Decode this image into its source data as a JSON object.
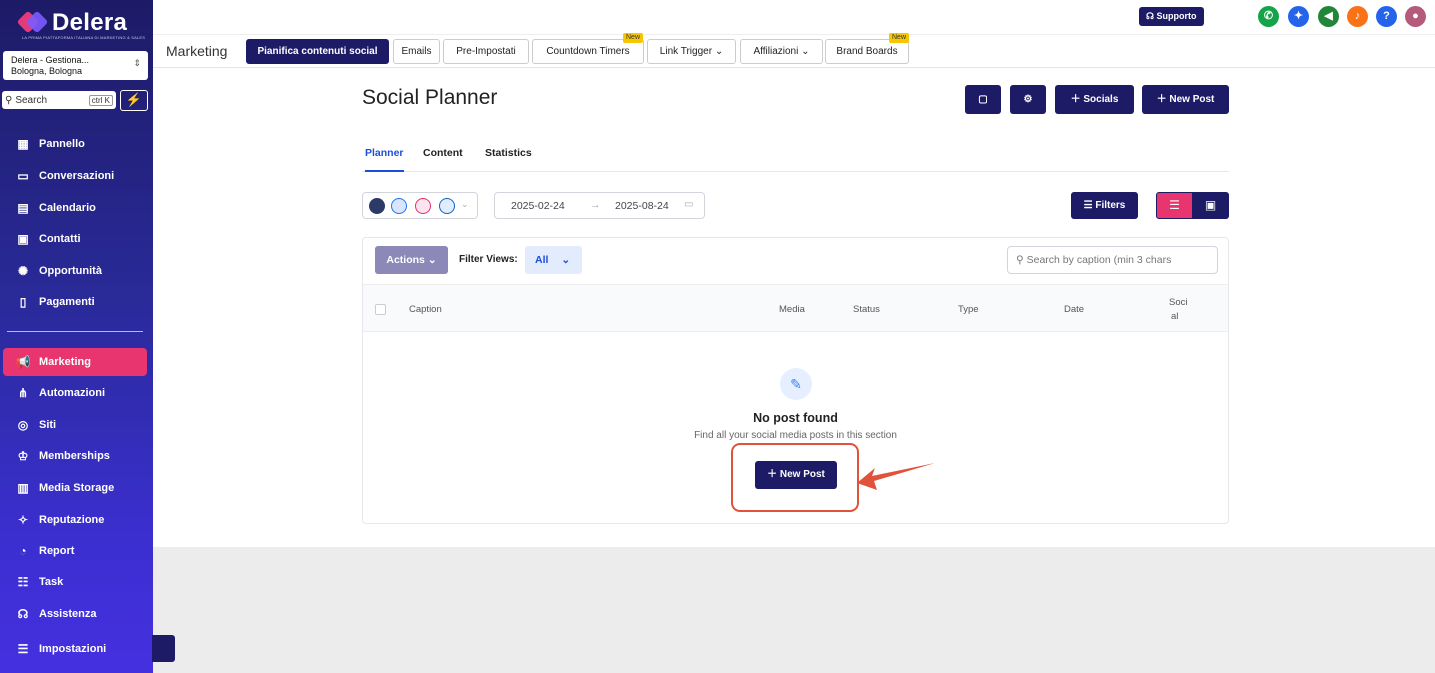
{
  "brand": {
    "name": "Delera",
    "tagline": "LA PRIMA PIATTAFORMA ITALIANA DI MARKETING & SALES",
    "accent": "#e8356f",
    "dark": "#1d1b66"
  },
  "location": {
    "name": "Delera - Gestiona...",
    "city": "Bologna, Bologna"
  },
  "sidebar_search": {
    "label": "Search",
    "shortcut": "ctrl K"
  },
  "nav": [
    {
      "label": "Pannello",
      "icon": "dashboard-icon"
    },
    {
      "label": "Conversazioni",
      "icon": "chat-icon"
    },
    {
      "label": "Calendario",
      "icon": "calendar-icon"
    },
    {
      "label": "Contatti",
      "icon": "contacts-icon"
    },
    {
      "label": "Opportunità",
      "icon": "opportunity-icon"
    },
    {
      "label": "Pagamenti",
      "icon": "payments-icon"
    },
    {
      "label": "Marketing",
      "icon": "megaphone-icon",
      "active": true
    },
    {
      "label": "Automazioni",
      "icon": "automation-icon"
    },
    {
      "label": "Siti",
      "icon": "globe-icon"
    },
    {
      "label": "Memberships",
      "icon": "crown-icon"
    },
    {
      "label": "Media Storage",
      "icon": "storage-icon"
    },
    {
      "label": "Reputazione",
      "icon": "star-icon"
    },
    {
      "label": "Report",
      "icon": "report-icon"
    },
    {
      "label": "Task",
      "icon": "task-icon"
    },
    {
      "label": "Assistenza",
      "icon": "support-icon"
    },
    {
      "label": "Impostazioni",
      "icon": "settings-icon"
    }
  ],
  "topbar": {
    "support_label": "Supporto"
  },
  "menubar": {
    "title": "Marketing",
    "tabs": [
      {
        "label": "Pianifica contenuti social",
        "active": true
      },
      {
        "label": "Emails"
      },
      {
        "label": "Pre-Impostati"
      },
      {
        "label": "Countdown Timers",
        "badge": "New"
      },
      {
        "label": "Link Trigger ⌄"
      },
      {
        "label": "Affiliazioni ⌄"
      },
      {
        "label": "Brand Boards",
        "badge": "New"
      }
    ]
  },
  "page": {
    "title": "Social Planner",
    "buttons": {
      "socials": "Socials",
      "new_post": "New Post"
    },
    "tabs": [
      "Planner",
      "Content",
      "Statistics"
    ],
    "date_from": "2025-02-24",
    "date_to": "2025-08-24",
    "filters_label": "Filters"
  },
  "table": {
    "actions_label": "Actions",
    "filter_views_label": "Filter Views:",
    "filter_views_value": "All",
    "search_placeholder": "Search by caption (min 3 chars",
    "columns": [
      "Caption",
      "Media",
      "Status",
      "Type",
      "Date",
      "Soci",
      "al"
    ],
    "empty_title": "No post found",
    "empty_subtitle": "Find all your social media posts in this section",
    "empty_button": "New Post"
  }
}
